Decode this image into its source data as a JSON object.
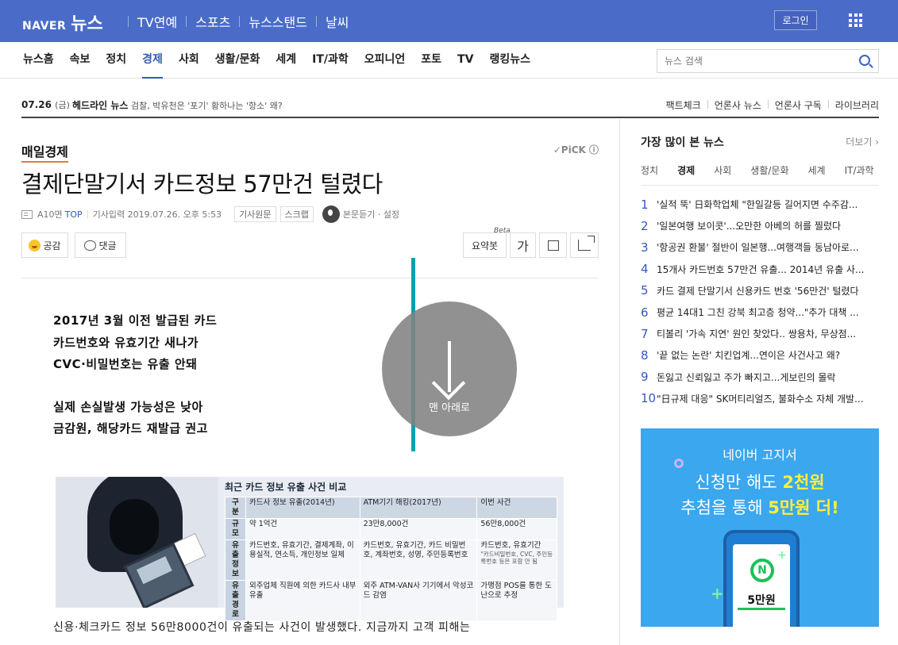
{
  "topbar": {
    "logo_naver": "NAVER",
    "logo_news": "뉴스",
    "nav": [
      "TV연예",
      "스포츠",
      "뉴스스탠드",
      "날씨"
    ],
    "login": "로그인",
    "colors": {
      "brand": "#4a6cc8"
    }
  },
  "mainnav": {
    "items": [
      "뉴스홈",
      "속보",
      "정치",
      "경제",
      "사회",
      "생활/문화",
      "세계",
      "IT/과학",
      "오피니언",
      "포토",
      "TV",
      "랭킹뉴스"
    ],
    "active": "경제",
    "search_placeholder": "뉴스 검색"
  },
  "headline": {
    "date": "07.26",
    "day": "(금)",
    "label": "헤드라인 뉴스",
    "text": "검찰, 박유천은 '포기' 황하나는 '항소' 왜?",
    "links": [
      "팩트체크",
      "언론사 뉴스",
      "언론사 구독",
      "라이브러리"
    ]
  },
  "article": {
    "press": "매일경제",
    "pick": "PiCK",
    "title": "결제단말기서 카드정보 57만건 털렸다",
    "page": "A10면",
    "top": "TOP",
    "datetime": "기사입력 2019.07.26. 오후 5:53",
    "original_btn": "기사원문",
    "scrap_btn": "스크랩",
    "listen": "본문듣기 ·",
    "settings": "설정",
    "like_btn": "공감",
    "comment_btn": "댓글",
    "summary_btn": "요약봇",
    "beta": "Beta",
    "font_btn": "가",
    "summary_lines": [
      "2017년 3월 이전 발급된 카드",
      "카드번호와 유효기간 새나가",
      "CVC·비밀번호는 유출 안돼",
      "실제 손실발생 가능성은 낮아",
      "금감원, 해당카드 재발급 권고"
    ],
    "body_first_line": "신용·체크카드 정보 56만8000건이 유출되는 사건이 발생했다. 지금까지 고객 피해는"
  },
  "infographic": {
    "title": "최근 카드 정보 유출 사건 비교",
    "headers": [
      "구분",
      "카드사 정보 유출(2014년)",
      "ATM기기 해킹(2017년)",
      "이번 사건"
    ],
    "rows": [
      {
        "label": "규모",
        "c1": "약 1억건",
        "c2": "23만8,000건",
        "c3": "56만8,000건"
      },
      {
        "label": "유출 정보",
        "c1": "카드번호, 유효기간, 결제계좌, 이용실적, 연소득, 개인정보 일체",
        "c2": "카드번호, 유효기간, 카드 비밀번호, 계좌번호, 성명, 주민등록번호",
        "c3": "카드번호, 유효기간",
        "c3_note": "\"카드비밀번호, CVC, 주민등록번호 등은 포함 안 됨"
      },
      {
        "label": "유출 경로",
        "c1": "외주업체 직원에 의한 카드사 내부 유출",
        "c2": "외주 ATM-VAN사 기기에서 악성코드 감염",
        "c3": "가맹점 POS를 통한 도난으로 추정"
      }
    ]
  },
  "scroll_overlay": {
    "label": "맨 아래로"
  },
  "sidebar": {
    "title": "가장 많이 본 뉴스",
    "more": "더보기 ›",
    "tabs": [
      "정치",
      "경제",
      "사회",
      "생활/문화",
      "세계",
      "IT/과학"
    ],
    "active_tab": "경제",
    "ranking": [
      {
        "num": "1",
        "title": "'실적 뚝' 日화학업체 \"한일갈등 길어지면 수주감..."
      },
      {
        "num": "2",
        "title": "'일본여행 보이콧'...오만한 아베의 허를 찔렀다"
      },
      {
        "num": "3",
        "title": "'항공권 환불' 절반이 일본행...여행객들 동남아로..."
      },
      {
        "num": "4",
        "title": "15개사 카드번호 57만건 유출... 2014년 유출 사..."
      },
      {
        "num": "5",
        "title": "카드 결제 단말기서 신용카드 번호 '56만건' 털렸다"
      },
      {
        "num": "6",
        "title": "평균 14대1 그친 강북 최고층 청약...\"추가 대책 ..."
      },
      {
        "num": "7",
        "title": "티볼리 '가속 지연' 원인 찾았다.. 쌍용차, 무상점..."
      },
      {
        "num": "8",
        "title": "'끝 없는 논란' 치킨업계...연이은 사건사고 왜?"
      },
      {
        "num": "9",
        "title": "돈잃고 신뢰잃고 주가 빠지고...게보린의 몰락"
      },
      {
        "num": "10",
        "title": "\"日규제 대응\" SK머티리얼즈, 불화수소 자체 개발..."
      }
    ]
  },
  "ad": {
    "line1": "네이버 고지서",
    "line2_a": "신청만 해도 ",
    "line2_b": "2천원",
    "line3_a": "추첨을 통해 ",
    "line3_b": "5만원 더!",
    "coin": "N",
    "won": "5만원"
  }
}
